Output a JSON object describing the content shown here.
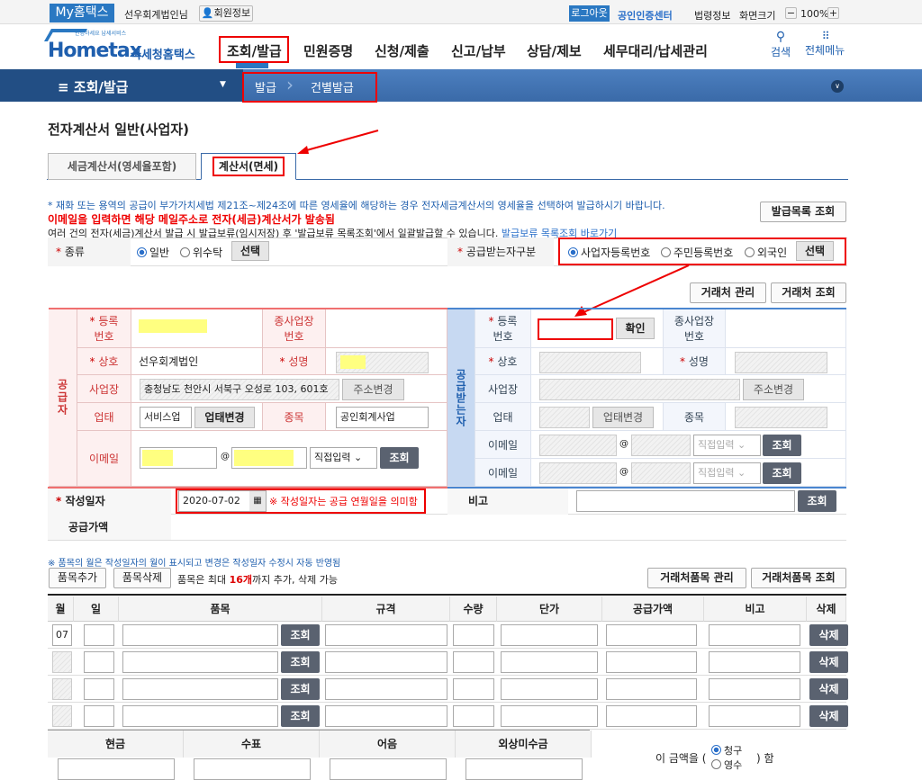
{
  "topbar": {
    "my": "My홈택스",
    "user": "선우회계법인님",
    "member": "회원정보",
    "logout": "로그아웃",
    "cert": "공인인증센터",
    "law": "법령정보",
    "zoom_label": "화면크기",
    "zoom": "100%",
    "minus": "−",
    "plus": "+"
  },
  "header": {
    "logo": "Hometax",
    "logo_sub": "국세청홈택스",
    "logo_small": "안녕하세요 납세서비스",
    "nav": [
      "조회/발급",
      "민원증명",
      "신청/제출",
      "신고/납부",
      "상담/제보",
      "세무대리/납세관리"
    ],
    "search": "검색",
    "menu": "전체메뉴"
  },
  "bar": {
    "menu": "조회/발급",
    "crumbs": [
      "발급",
      "건별발급"
    ]
  },
  "page": {
    "title": "전자계산서 일반(사업자)",
    "tabs": [
      "세금계산서(영세율포함)",
      "계산서(면세)"
    ],
    "notice1": "* 재화 또는 용역의 공급이 부가가치세법 제21조~제24조에 따른 영세율에 해당하는 경우 전자세금계산서의 영세율을 선택하여 발급하시기 바랍니다.",
    "notice2": "이메일을 입력하면 해당 메일주소로 전자(세금)계산서가 발송됨",
    "notice3a": "여러 건의 전자(세금)계산서 발급 시 발급보류(임시저장) 후 '발급보류 목록조회'에서 일괄발급할 수 있습니다.",
    "notice3link": "발급보류 목록조회 바로가기",
    "issue_list": "발급목록 조회"
  },
  "kind": {
    "label": "종류",
    "options": [
      "일반",
      "위수탁"
    ],
    "select": "선택"
  },
  "recvtype": {
    "label": "공급받는자구분",
    "options": [
      "사업자등록번호",
      "주민등록번호",
      "외국인"
    ],
    "select": "선택"
  },
  "partner": {
    "manage": "거래처 관리",
    "lookup": "거래처 조회"
  },
  "supplier": {
    "side": "공급자",
    "reg": "등록\n번호",
    "sub": "종사업장\n번호",
    "name": "상호",
    "name_value": "선우회계법인",
    "ceo": "성명",
    "addr": "사업장",
    "addr_value": "충청남도 천안시 서북구 오성로 103, 601호",
    "addr_btn": "주소변경",
    "type": "업태",
    "type_value": "서비스업",
    "type_btn": "업태변경",
    "item": "종목",
    "item_value": "공인회계사업",
    "email": "이메일",
    "at": "@",
    "domain": "직접입력",
    "lookup": "조회"
  },
  "receiver": {
    "side": "공급받는자",
    "reg": "등록\n번호",
    "confirm": "확인",
    "sub": "종사업장\n번호",
    "name": "상호",
    "ceo": "성명",
    "addr": "사업장",
    "addr_btn": "주소변경",
    "type": "업태",
    "type_btn": "업태변경",
    "item": "종목",
    "email": "이메일",
    "at": "@",
    "domain": "직접입력",
    "lookup": "조회"
  },
  "date": {
    "label": "작성일자",
    "value": "2020-07-02",
    "note": "※ 작성일자는 공급 연월일을 의미함",
    "memo": "비고",
    "lookup": "조회",
    "supply": "공급가액"
  },
  "items": {
    "note": "※ 품목의 월은 작성일자의 월이 표시되고 변경은 작성일자 수정시 자동 반영됨",
    "add": "품목추가",
    "del": "품목삭제",
    "limit_a": "품목은 최대 ",
    "limit_b": "16개",
    "limit_c": "까지 추가, 삭제 가능",
    "manage": "거래처품목 관리",
    "lookup": "거래처품목 조회",
    "headers": [
      "월",
      "일",
      "품목",
      "규격",
      "수량",
      "단가",
      "공급가액",
      "비고",
      "삭제"
    ],
    "rows": [
      {
        "month": "07",
        "btn": "조회",
        "del": "삭제"
      },
      {
        "month": "",
        "btn": "조회",
        "del": "삭제"
      },
      {
        "month": "",
        "btn": "조회",
        "del": "삭제"
      },
      {
        "month": "",
        "btn": "조회",
        "del": "삭제"
      }
    ]
  },
  "payment": {
    "headers": [
      "현금",
      "수표",
      "어음",
      "외상미수금"
    ],
    "amount_a": "이 금액을 (",
    "amount_b": ") 함",
    "options": [
      "청구",
      "영수"
    ]
  }
}
